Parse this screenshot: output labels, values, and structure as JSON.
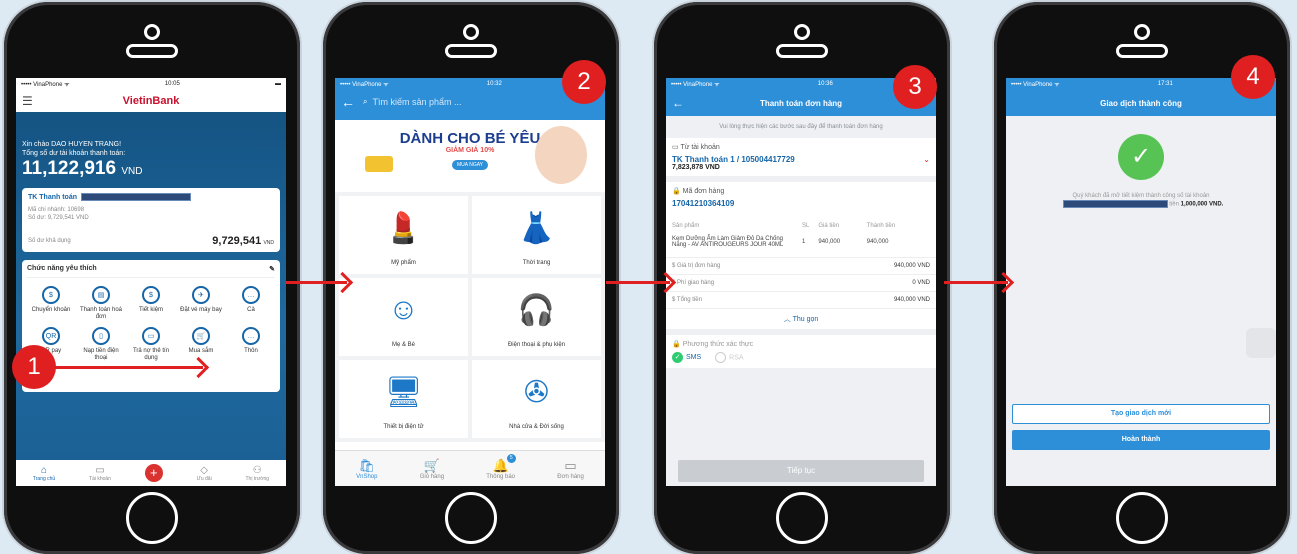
{
  "steps": [
    "1",
    "2",
    "3",
    "4"
  ],
  "s1": {
    "carrier": "••••• VinaPhone ᯤ",
    "time": "10:05",
    "logo": "VietinBank",
    "greeting": "Xin chào DAO HUYEN TRANG!",
    "total_label": "Tổng số dư tài khoản thanh toán:",
    "total": "11,122,916",
    "currency": "VND",
    "acct_title": "TK Thanh toán",
    "branch": "Mã chi nhánh: 10698",
    "balance_line": "Số dư: 9,729,541 VND",
    "avail_label": "Số dư khả dụng",
    "avail": "9,729,541",
    "avail_cur": "VND",
    "fav_title": "Chức năng yêu thích",
    "items": [
      {
        "icon": "$",
        "label": "Chuyển khoản"
      },
      {
        "icon": "▤",
        "label": "Thanh toán hoá đơn"
      },
      {
        "icon": "$",
        "label": "Tiết kiệm"
      },
      {
        "icon": "✈",
        "label": "Đặt vé máy bay"
      },
      {
        "icon": "…",
        "label": "Cả"
      },
      {
        "icon": "QR",
        "label": "QR pay"
      },
      {
        "icon": "▯",
        "label": "Nạp tiền điện thoại"
      },
      {
        "icon": "▭",
        "label": "Trả nợ thẻ tín dụng"
      },
      {
        "icon": "🛒",
        "label": "Mua sắm"
      },
      {
        "icon": "…",
        "label": "Thôn"
      }
    ],
    "tabs": [
      "Trang chủ",
      "Tài khoản",
      "+",
      "Ưu đãi",
      "Thị trường"
    ]
  },
  "s2": {
    "carrier": "••••• VinaPhone ᯤ",
    "time": "10:32",
    "search": "Tìm kiếm sản phẩm ...",
    "banner_title": "DÀNH CHO BÉ YÊU",
    "banner_sub": "GIẢM GIÁ 10%",
    "banner_btn": "MUA NGAY",
    "cats": [
      "Mỹ phẩm",
      "Thời trang",
      "Mẹ & Bé",
      "Điện thoại & phụ kiện",
      "Thiết bị điện tử",
      "Nhà cửa & Đời sống"
    ],
    "tabs": [
      "VnShop",
      "Giỏ hàng",
      "Thông báo",
      "Đơn hàng"
    ],
    "notif": "5"
  },
  "s3": {
    "carrier": "••••• VinaPhone ᯤ",
    "time": "10:36",
    "title": "Thanh toán đơn hàng",
    "note": "Vui lòng thực hiện các bước sau đây để thanh toán đơn hàng",
    "from_label": "Từ tài khoản",
    "acct": "TK Thanh toán 1 / 105004417729",
    "acct_bal": "7,823,878 VND",
    "order_label": "Mã đơn hàng",
    "order": "17041210364109",
    "h_prod": "Sản phẩm",
    "h_qty": "SL",
    "h_price": "Giá tiền",
    "h_total": "Thành tiền",
    "prod": "Kem Dưỡng Ẩm Làm Giảm Đỏ Da Chống Nắng - AV ANTIROUGEURS JOUR 40ML",
    "qty": "1",
    "price": "940,000",
    "total": "940,000",
    "sum1_l": "Giá trị đơn hàng",
    "sum1_v": "940,000 VND",
    "sum2_l": "Phí giao hàng",
    "sum2_v": "0 VND",
    "sum3_l": "Tổng tiền",
    "sum3_v": "940,000 VND",
    "collapse": "Thu gọn",
    "auth_label": "Phương thức xác thực",
    "sms": "SMS",
    "rsa": "RSA",
    "continue": "Tiếp tục"
  },
  "s4": {
    "carrier": "••••• VinaPhone ᯤ",
    "time": "17:31",
    "title": "Giao dịch thành công",
    "msg": "Quý khách đã mở tiết kiệm thành công số tài khoản",
    "msg2": "tiền",
    "amount": "1,000,000 VND.",
    "btn_new": "Tạo giao dịch mới",
    "btn_done": "Hoàn thành"
  }
}
